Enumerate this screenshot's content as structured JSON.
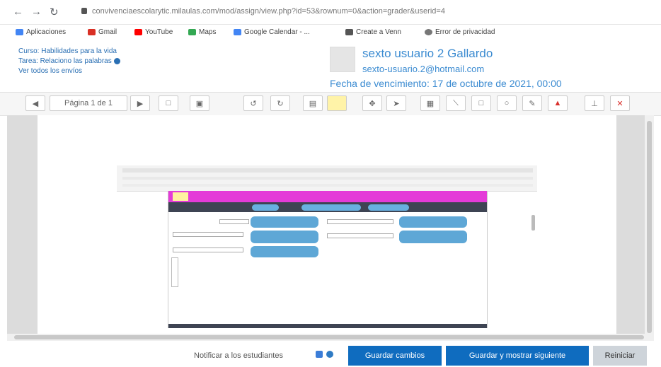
{
  "browser": {
    "url": "convivenciaescolarytic.milaulas.com/mod/assign/view.php?id=53&rownum=0&action=grader&userid=4",
    "bookmarks": [
      "Aplicaciones",
      "Gmail",
      "YouTube",
      "Maps",
      "Google Calendar - ...",
      "Create a Venn",
      "Error de privacidad"
    ]
  },
  "course": {
    "line1": "Curso: Habilidades para la vida",
    "line2": "Tarea: Relaciono las palabras",
    "line3": "Ver todos los envíos"
  },
  "user": {
    "name": "sexto usuario 2 Gallardo",
    "email": "sexto-usuario.2@hotmail.com",
    "due": "Fecha de vencimiento: 17 de octubre de 2021, 00:00"
  },
  "toolbar": {
    "page_label": "Página 1 de 1"
  },
  "footer": {
    "notify_label": "Notificar a los estudiantes",
    "save_label": "Guardar cambios",
    "save_next_label": "Guardar y mostrar siguiente",
    "reset_label": "Reiniciar"
  },
  "colors": {
    "link": "#2a6fb3",
    "accent": "#3b8bd1",
    "primary": "#0f6cbf",
    "magenta": "#e43bd8"
  }
}
